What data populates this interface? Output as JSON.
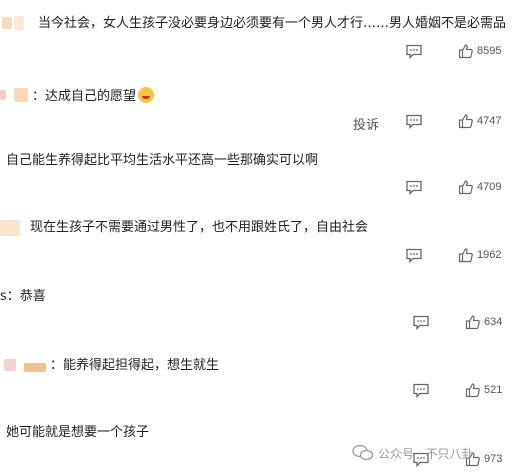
{
  "comments": [
    {
      "text": "当今社会，女人生孩子没必要身边必须要有一个男人才行……男人婚姻不是必需品",
      "likes": "8595",
      "colors": [
        "#f7dcc0",
        "#fbe9d6"
      ]
    },
    {
      "text": "：达成自己的愿望",
      "likes": "4747",
      "report": "投诉",
      "colors": [
        "#f6c9c9",
        "#f9d8b8"
      ]
    },
    {
      "text": "自己能生养得起比平均生活水平还高一些那确实可以啊",
      "likes": "4709",
      "colors": []
    },
    {
      "text": "现在生孩子不需要通过男性了，也不用跟姓氏了，自由社会",
      "likes": "1962",
      "colors": [
        "#fbe4cc"
      ]
    },
    {
      "text": "s：恭喜",
      "likes": "634",
      "colors": []
    },
    {
      "text": "：能养得起担得起，想生就生",
      "likes": "521",
      "colors": [
        "#f6d0d0",
        "#f0c090"
      ]
    },
    {
      "text": "她可能就是想要一个孩子",
      "likes": "973",
      "colors": []
    }
  ],
  "watermark": {
    "text": "公众号 · 不只八卦"
  }
}
